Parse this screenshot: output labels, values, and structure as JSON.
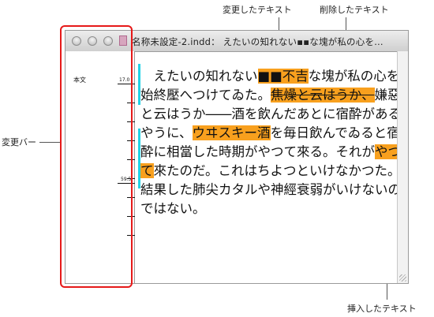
{
  "callouts": {
    "changed": "変更したテキスト",
    "deleted": "削除したテキスト",
    "changebar": "変更バー",
    "inserted": "挿入したテキスト"
  },
  "window": {
    "title": "名称未設定-2.indd： えたいの知れない▪▪な塊が私の心を…"
  },
  "left_pane": {
    "style_name": "本文",
    "depth_top": "17.0",
    "depth_mid": "59.5"
  },
  "text": {
    "line1_a": "　えたいの知れない",
    "line1_b": "■■不吉",
    "line1_c": "な塊が私の心を",
    "line2_a": "始終壓へつけてゐた。",
    "line2_b": "焦燥と云はうか、",
    "line2_c": "嫌惡",
    "line3": "と云はうか――酒を飲んだあとに宿酔がある",
    "line4_a": "やうに、",
    "line4_b": "ウヰスキー酒",
    "line4_c": "を毎日飲んでゐると宿",
    "line5_a": "酔に相當した時期がやつて來る。それが",
    "line5_b": "やつ",
    "line6_a": "て",
    "line6_b": "來たのだ。これはちよつといけなかつた。",
    "line7": "結果した肺尖カタルや神經衰弱がいけないの",
    "line8": "ではない。"
  },
  "colors": {
    "highlight": "#f8a01e",
    "changebar": "#22d2e6",
    "callout_box": "#e61919"
  }
}
